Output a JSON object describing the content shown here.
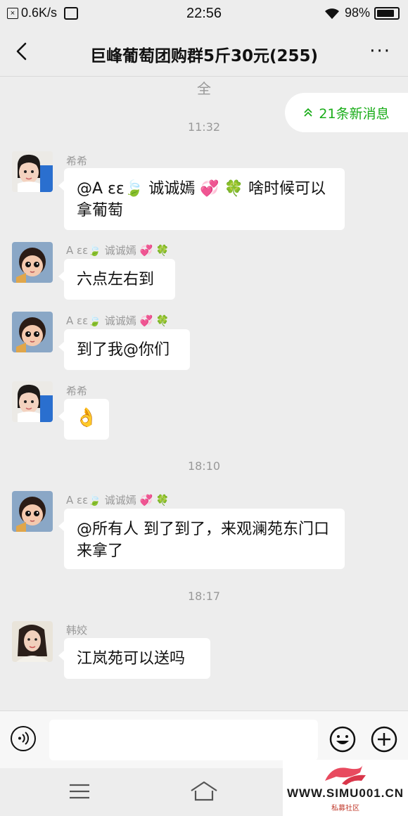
{
  "status_bar": {
    "speed": "0.6K/s",
    "time": "22:56",
    "battery": "98%",
    "battery_level": 0.98
  },
  "header": {
    "title": "巨峰葡萄团购群5斤30元(255)"
  },
  "chat": {
    "partial_top_text": "全",
    "new_messages_label": "21条新消息",
    "messages": [
      {
        "timestamp": "11:32",
        "sender": "希希",
        "text": "@A   εε🍃   诚诚嫣  💞  🍀 啥时候可以拿葡萄"
      },
      {
        "sender": "A   εε🍃   诚诚嫣  💞  🍀",
        "text": "六点左右到"
      },
      {
        "sender": "A   εε🍃   诚诚嫣  💞  🍀",
        "text": "到了我@你们"
      },
      {
        "sender": "希希",
        "text": "👌"
      },
      {
        "timestamp": "18:10",
        "sender": "A   εε🍃   诚诚嫣  💞  🍀",
        "text": "@所有人   到了到了，来观澜苑东门口来拿了"
      },
      {
        "timestamp": "18:17",
        "sender": "韩姣",
        "text": "江岚苑可以送吗"
      }
    ]
  },
  "input_bar": {
    "placeholder": ""
  },
  "watermark": {
    "text": "WWW.SIMU001.CN",
    "subtitle": "私募社区"
  },
  "colors": {
    "background": "#ededed",
    "accent_green": "#1aad19",
    "bubble": "#ffffff"
  }
}
